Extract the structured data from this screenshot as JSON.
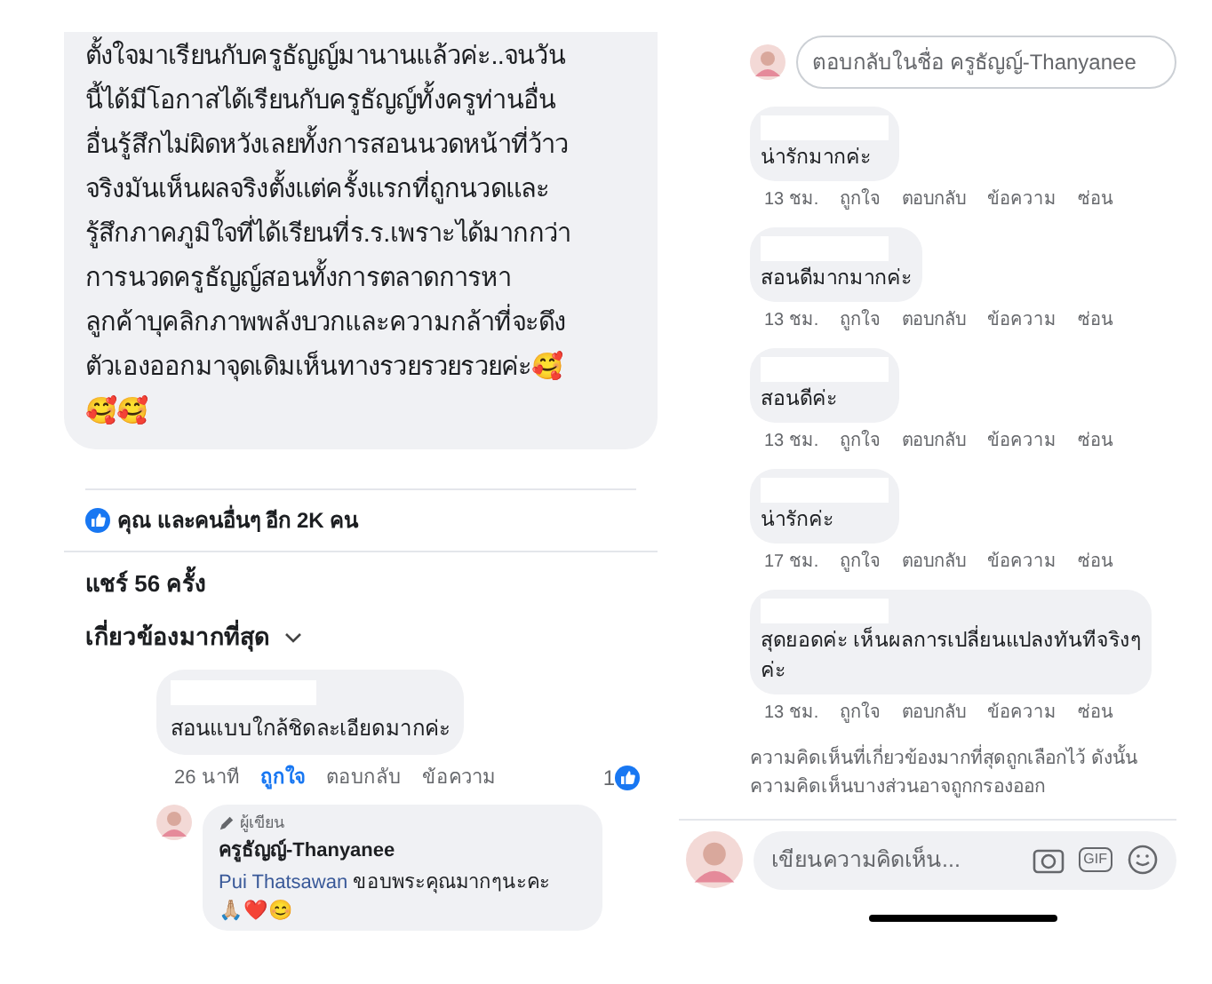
{
  "left_panel": {
    "post_comment": {
      "text": "ตั้งใจมาเรียนกับครูธัญญ์มานานแล้วค่ะ..จนวัน\nนี้ได้มีโอกาสได้เรียนกับครูธัญญ์ทั้งครูท่านอื่น\nอื่นรู้สึกไม่ผิดหวังเลยทั้งการสอนนวดหน้าที่ว้าว\nจริงมันเห็นผลจริงตั้งแต่ครั้งแรกที่ถูกนวดและ\nรู้สึกภาคภูมิใจที่ได้เรียนที่ร.ร.เพราะได้มากกว่า\nการนวดครูธัญญ์สอนทั้งการตลาดการหา\nลูกค้าบุคลิกภาพพลังบวกและความกล้าที่จะดึง\nตัวเองออกมาจุดเดิมเห็นทางรวยรวยรวยค่ะ🥰\n🥰🥰"
    },
    "reactions": "คุณ และคนอื่นๆ อีก 2K คน",
    "shares": "แชร์ 56 ครั้ง",
    "sort": "เกี่ยวข้องมากที่สุด",
    "comment": {
      "text": "สอนแบบใกล้ชิดละเอียดมากค่ะ",
      "time": "26 นาที",
      "actions": [
        {
          "label": "ถูกใจ",
          "selected": true
        },
        {
          "label": "ตอบกลับ",
          "selected": false
        },
        {
          "label": "ข้อความ",
          "selected": false
        }
      ],
      "like_count": "1"
    },
    "reply": {
      "badge": "ผู้เขียน",
      "author": "ครูธัญญ์-Thanyanee",
      "mention": "Pui Thatsawan",
      "text": "ขอบพระคุณมากๆนะคะ",
      "emojis": "🙏🏼❤️😊"
    }
  },
  "right_panel": {
    "reply_field": {
      "placeholder": "ตอบกลับในชื่อ ครูธัญญ์-Thanyanee"
    },
    "comments": [
      {
        "text": "น่ารักมากค่ะ",
        "time": "13 ชม.",
        "actions": [
          "ถูกใจ",
          "ตอบกลับ",
          "ข้อความ",
          "ซ่อน"
        ]
      },
      {
        "text": "สอนดีมากมากค่ะ",
        "time": "13 ชม.",
        "actions": [
          "ถูกใจ",
          "ตอบกลับ",
          "ข้อความ",
          "ซ่อน"
        ]
      },
      {
        "text": "สอนดีค่ะ",
        "time": "13 ชม.",
        "actions": [
          "ถูกใจ",
          "ตอบกลับ",
          "ข้อความ",
          "ซ่อน"
        ]
      },
      {
        "text": "น่ารักค่ะ",
        "time": "17 ชม.",
        "actions": [
          "ถูกใจ",
          "ตอบกลับ",
          "ข้อความ",
          "ซ่อน"
        ]
      },
      {
        "text": "สุดยอดค่ะ เห็นผลการเปลี่ยนแปลงทันทีจริงๆ\nค่ะ",
        "time": "13 ชม.",
        "actions": [
          "ถูกใจ",
          "ตอบกลับ",
          "ข้อความ",
          "ซ่อน"
        ]
      }
    ],
    "notice": "ความคิดเห็นที่เกี่ยวข้องมากที่สุดถูกเลือกไว้ ดังนั้น\nความคิดเห็นบางส่วนอาจถูกกรองออก",
    "composer": {
      "placeholder": "เขียนความคิดเห็น...",
      "gif": "GIF"
    }
  }
}
